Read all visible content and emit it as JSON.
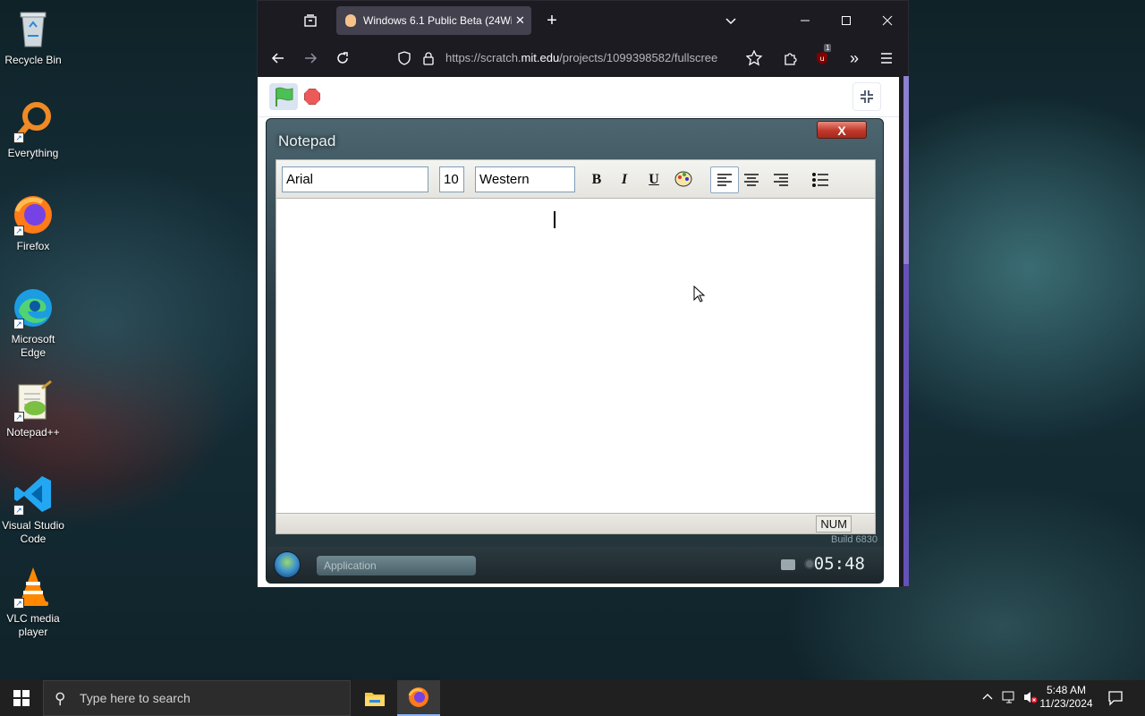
{
  "desktop": {
    "icons": [
      {
        "label": "Recycle Bin"
      },
      {
        "label": "Everything"
      },
      {
        "label": "Firefox"
      },
      {
        "label": "Microsoft Edge"
      },
      {
        "label": "Notepad++"
      },
      {
        "label": "Visual Studio Code"
      },
      {
        "label": "VLC media player"
      }
    ]
  },
  "browser": {
    "tab_title": "Windows 6.1 Public Beta (24Wi",
    "url_prefix": "https://scratch.",
    "url_domain": "mit.edu",
    "url_rest": "/projects/1099398582/fullscree",
    "extension_badge": "1"
  },
  "notepad": {
    "title": "Notepad",
    "close_label": "X",
    "font": "Arial",
    "size": "10",
    "script": "Western",
    "bold": "B",
    "italic": "I",
    "underline": "U",
    "status_num": "NUM",
    "build": "Build 6830",
    "taskbar_app": "Application",
    "clock": "05:48"
  },
  "taskbar": {
    "search_placeholder": "Type here to search",
    "time": "5:48 AM",
    "date": "11/23/2024"
  }
}
